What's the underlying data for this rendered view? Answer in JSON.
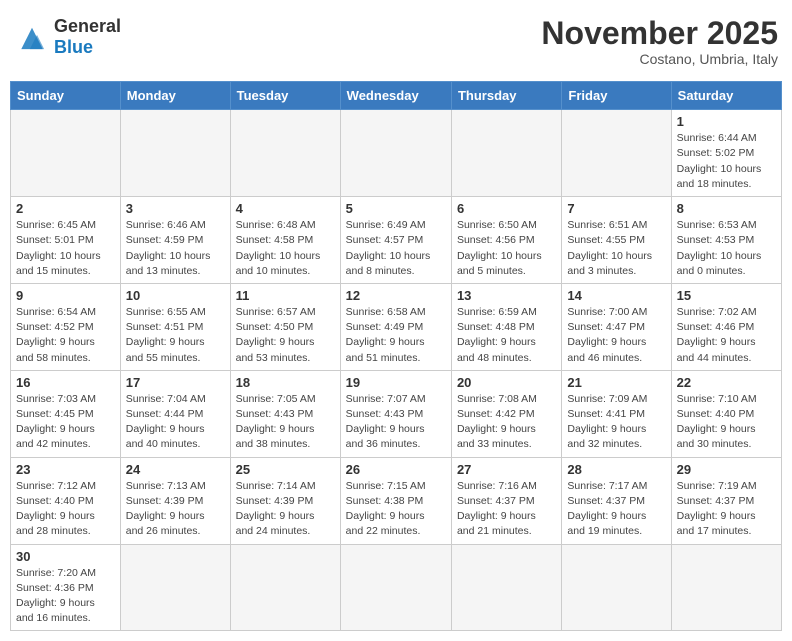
{
  "header": {
    "logo_general": "General",
    "logo_blue": "Blue",
    "month_title": "November 2025",
    "subtitle": "Costano, Umbria, Italy"
  },
  "weekdays": [
    "Sunday",
    "Monday",
    "Tuesday",
    "Wednesday",
    "Thursday",
    "Friday",
    "Saturday"
  ],
  "weeks": [
    [
      {
        "day": "",
        "info": ""
      },
      {
        "day": "",
        "info": ""
      },
      {
        "day": "",
        "info": ""
      },
      {
        "day": "",
        "info": ""
      },
      {
        "day": "",
        "info": ""
      },
      {
        "day": "",
        "info": ""
      },
      {
        "day": "1",
        "info": "Sunrise: 6:44 AM\nSunset: 5:02 PM\nDaylight: 10 hours\nand 18 minutes."
      }
    ],
    [
      {
        "day": "2",
        "info": "Sunrise: 6:45 AM\nSunset: 5:01 PM\nDaylight: 10 hours\nand 15 minutes."
      },
      {
        "day": "3",
        "info": "Sunrise: 6:46 AM\nSunset: 4:59 PM\nDaylight: 10 hours\nand 13 minutes."
      },
      {
        "day": "4",
        "info": "Sunrise: 6:48 AM\nSunset: 4:58 PM\nDaylight: 10 hours\nand 10 minutes."
      },
      {
        "day": "5",
        "info": "Sunrise: 6:49 AM\nSunset: 4:57 PM\nDaylight: 10 hours\nand 8 minutes."
      },
      {
        "day": "6",
        "info": "Sunrise: 6:50 AM\nSunset: 4:56 PM\nDaylight: 10 hours\nand 5 minutes."
      },
      {
        "day": "7",
        "info": "Sunrise: 6:51 AM\nSunset: 4:55 PM\nDaylight: 10 hours\nand 3 minutes."
      },
      {
        "day": "8",
        "info": "Sunrise: 6:53 AM\nSunset: 4:53 PM\nDaylight: 10 hours\nand 0 minutes."
      }
    ],
    [
      {
        "day": "9",
        "info": "Sunrise: 6:54 AM\nSunset: 4:52 PM\nDaylight: 9 hours\nand 58 minutes."
      },
      {
        "day": "10",
        "info": "Sunrise: 6:55 AM\nSunset: 4:51 PM\nDaylight: 9 hours\nand 55 minutes."
      },
      {
        "day": "11",
        "info": "Sunrise: 6:57 AM\nSunset: 4:50 PM\nDaylight: 9 hours\nand 53 minutes."
      },
      {
        "day": "12",
        "info": "Sunrise: 6:58 AM\nSunset: 4:49 PM\nDaylight: 9 hours\nand 51 minutes."
      },
      {
        "day": "13",
        "info": "Sunrise: 6:59 AM\nSunset: 4:48 PM\nDaylight: 9 hours\nand 48 minutes."
      },
      {
        "day": "14",
        "info": "Sunrise: 7:00 AM\nSunset: 4:47 PM\nDaylight: 9 hours\nand 46 minutes."
      },
      {
        "day": "15",
        "info": "Sunrise: 7:02 AM\nSunset: 4:46 PM\nDaylight: 9 hours\nand 44 minutes."
      }
    ],
    [
      {
        "day": "16",
        "info": "Sunrise: 7:03 AM\nSunset: 4:45 PM\nDaylight: 9 hours\nand 42 minutes."
      },
      {
        "day": "17",
        "info": "Sunrise: 7:04 AM\nSunset: 4:44 PM\nDaylight: 9 hours\nand 40 minutes."
      },
      {
        "day": "18",
        "info": "Sunrise: 7:05 AM\nSunset: 4:43 PM\nDaylight: 9 hours\nand 38 minutes."
      },
      {
        "day": "19",
        "info": "Sunrise: 7:07 AM\nSunset: 4:43 PM\nDaylight: 9 hours\nand 36 minutes."
      },
      {
        "day": "20",
        "info": "Sunrise: 7:08 AM\nSunset: 4:42 PM\nDaylight: 9 hours\nand 33 minutes."
      },
      {
        "day": "21",
        "info": "Sunrise: 7:09 AM\nSunset: 4:41 PM\nDaylight: 9 hours\nand 32 minutes."
      },
      {
        "day": "22",
        "info": "Sunrise: 7:10 AM\nSunset: 4:40 PM\nDaylight: 9 hours\nand 30 minutes."
      }
    ],
    [
      {
        "day": "23",
        "info": "Sunrise: 7:12 AM\nSunset: 4:40 PM\nDaylight: 9 hours\nand 28 minutes."
      },
      {
        "day": "24",
        "info": "Sunrise: 7:13 AM\nSunset: 4:39 PM\nDaylight: 9 hours\nand 26 minutes."
      },
      {
        "day": "25",
        "info": "Sunrise: 7:14 AM\nSunset: 4:39 PM\nDaylight: 9 hours\nand 24 minutes."
      },
      {
        "day": "26",
        "info": "Sunrise: 7:15 AM\nSunset: 4:38 PM\nDaylight: 9 hours\nand 22 minutes."
      },
      {
        "day": "27",
        "info": "Sunrise: 7:16 AM\nSunset: 4:37 PM\nDaylight: 9 hours\nand 21 minutes."
      },
      {
        "day": "28",
        "info": "Sunrise: 7:17 AM\nSunset: 4:37 PM\nDaylight: 9 hours\nand 19 minutes."
      },
      {
        "day": "29",
        "info": "Sunrise: 7:19 AM\nSunset: 4:37 PM\nDaylight: 9 hours\nand 17 minutes."
      }
    ],
    [
      {
        "day": "30",
        "info": "Sunrise: 7:20 AM\nSunset: 4:36 PM\nDaylight: 9 hours\nand 16 minutes."
      },
      {
        "day": "",
        "info": ""
      },
      {
        "day": "",
        "info": ""
      },
      {
        "day": "",
        "info": ""
      },
      {
        "day": "",
        "info": ""
      },
      {
        "day": "",
        "info": ""
      },
      {
        "day": "",
        "info": ""
      }
    ]
  ]
}
